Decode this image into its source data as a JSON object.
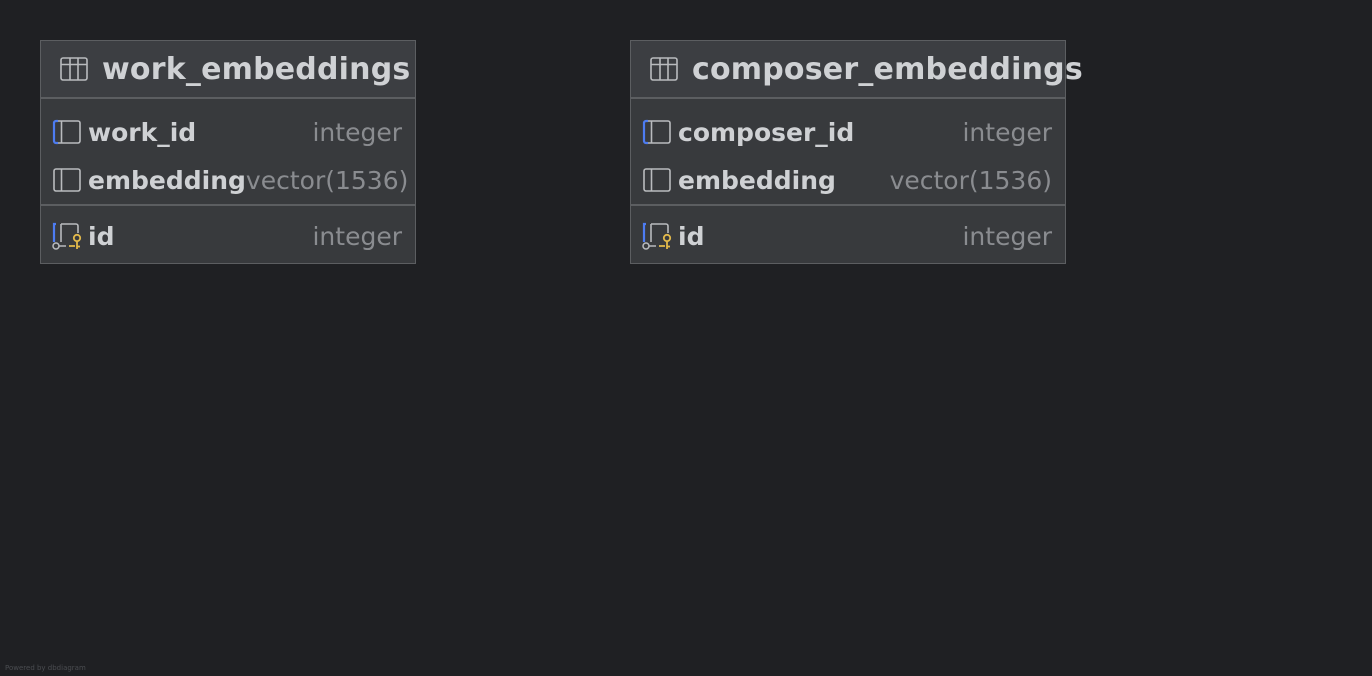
{
  "tables": [
    {
      "name": "work_embeddings",
      "columns": [
        {
          "name": "work_id",
          "type": "integer",
          "icon": "foreign-key-column-icon"
        },
        {
          "name": "embedding",
          "type": "vector(1536)",
          "icon": "column-icon"
        }
      ],
      "primary_key": {
        "name": "id",
        "type": "integer",
        "icon": "primary-key-column-icon"
      }
    },
    {
      "name": "composer_embeddings",
      "columns": [
        {
          "name": "composer_id",
          "type": "integer",
          "icon": "foreign-key-column-icon"
        },
        {
          "name": "embedding",
          "type": "vector(1536)",
          "icon": "column-icon"
        }
      ],
      "primary_key": {
        "name": "id",
        "type": "integer",
        "icon": "primary-key-column-icon"
      }
    }
  ],
  "watermark": "Powered by dbdiagram",
  "colors": {
    "background": "#1f2023",
    "table_fill": "#383a3d",
    "table_border": "#5c5e61",
    "text": "#cfd1d4",
    "type_text": "#8a8c90",
    "fk_accent": "#4d7cf2",
    "key_accent": "#e2b94a"
  }
}
